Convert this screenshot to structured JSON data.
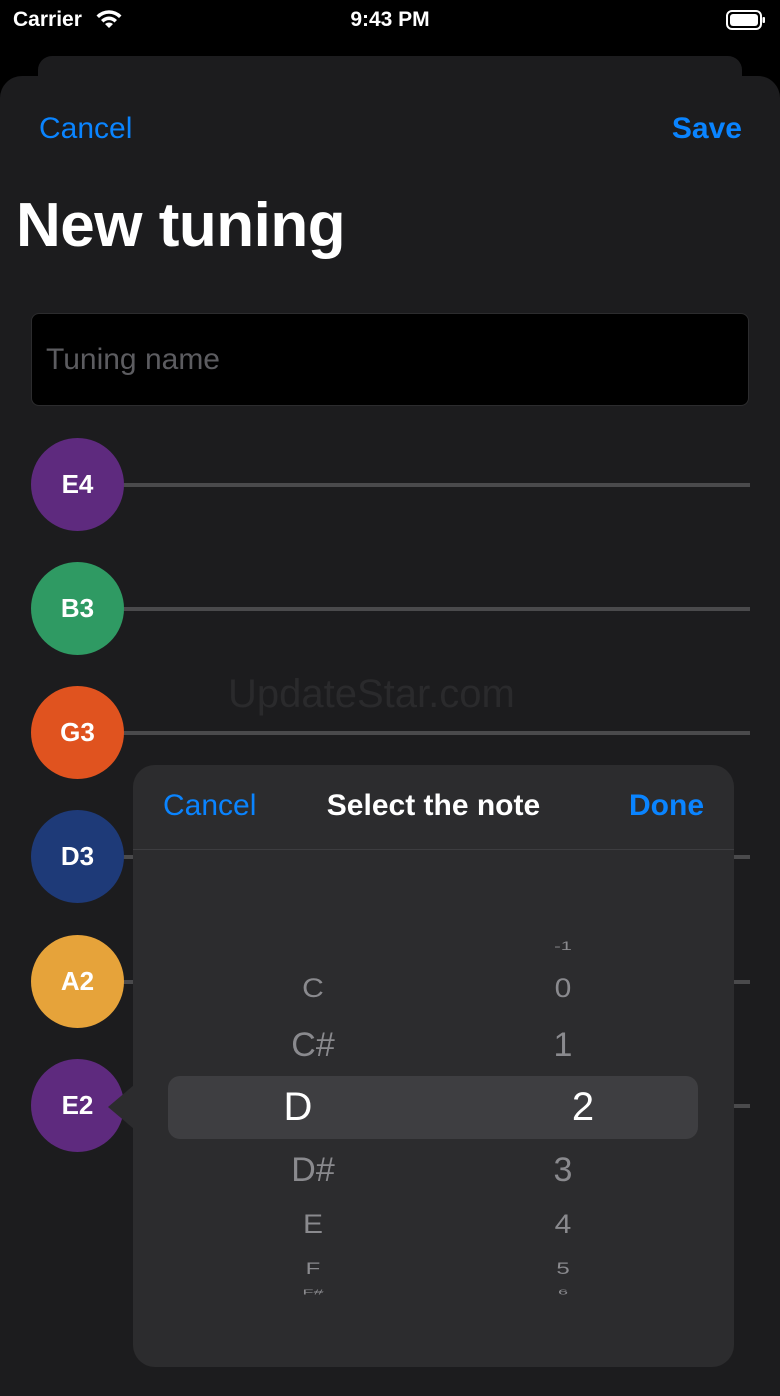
{
  "status_bar": {
    "carrier": "Carrier",
    "time": "9:43 PM"
  },
  "nav": {
    "cancel": "Cancel",
    "save": "Save"
  },
  "title": "New tuning",
  "tuning_field": {
    "placeholder": "Tuning name",
    "value": ""
  },
  "strings": [
    {
      "note": "E4",
      "color": "#5e2a7e"
    },
    {
      "note": "B3",
      "color": "#2f9a63"
    },
    {
      "note": "G3",
      "color": "#e0531f"
    },
    {
      "note": "D3",
      "color": "#1e3a78"
    },
    {
      "note": "A2",
      "color": "#e6a33a"
    },
    {
      "note": "E2",
      "color": "#5e2a7e"
    }
  ],
  "watermark": "UpdateStar.com",
  "picker": {
    "cancel": "Cancel",
    "title": "Select the note",
    "done": "Done",
    "notes": [
      "C",
      "C#",
      "D",
      "D#",
      "E",
      "F",
      "F#"
    ],
    "selected_note": "D",
    "octaves": [
      "-1",
      "0",
      "1",
      "2",
      "3",
      "4",
      "5",
      "6"
    ],
    "selected_octave": "2"
  },
  "colors": {
    "accent": "#0a84ff",
    "sheet": "#1c1c1e",
    "popover": "#2c2c2e"
  }
}
